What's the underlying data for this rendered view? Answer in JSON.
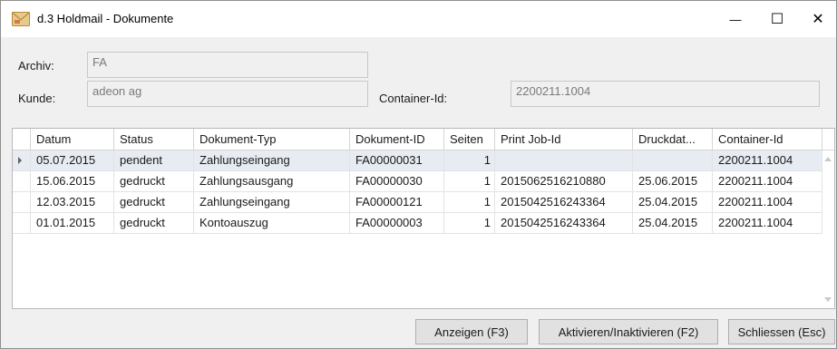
{
  "window": {
    "title": "d.3 Holdmail - Dokumente",
    "icon": "envelope-icon",
    "controls": {
      "minimize": "—",
      "maximize": "☐",
      "close": "✕"
    }
  },
  "form": {
    "archiv_label": "Archiv:",
    "archiv_value": "FA",
    "kunde_label": "Kunde:",
    "kunde_value": "adeon ag",
    "container_label": "Container-Id:",
    "container_value": "2200211.1004"
  },
  "table": {
    "columns": [
      "Datum",
      "Status",
      "Dokument-Typ",
      "Dokument-ID",
      "Seiten",
      "Print Job-Id",
      "Druckdat...",
      "Container-Id"
    ],
    "rows": [
      [
        "05.07.2015",
        "pendent",
        "Zahlungseingang",
        "FA00000031",
        "1",
        "",
        "",
        "2200211.1004"
      ],
      [
        "15.06.2015",
        "gedruckt",
        "Zahlungsausgang",
        "FA00000030",
        "1",
        "2015062516210880",
        "25.06.2015",
        "2200211.1004"
      ],
      [
        "12.03.2015",
        "gedruckt",
        "Zahlungseingang",
        "FA00000121",
        "1",
        "2015042516243364",
        "25.04.2015",
        "2200211.1004"
      ],
      [
        "01.01.2015",
        "gedruckt",
        "Kontoauszug",
        "FA00000003",
        "1",
        "2015042516243364",
        "25.04.2015",
        "2200211.1004"
      ]
    ],
    "selected_row": 0
  },
  "buttons": {
    "show": "Anzeigen (F3)",
    "toggle": "Aktivieren/Inaktivieren (F2)",
    "close": "Schliessen (Esc)"
  },
  "colors": {
    "selected_row_bg": "#e7ebf2",
    "button_bg": "#e1e1e1",
    "window_bg": "#f0f0f0"
  }
}
